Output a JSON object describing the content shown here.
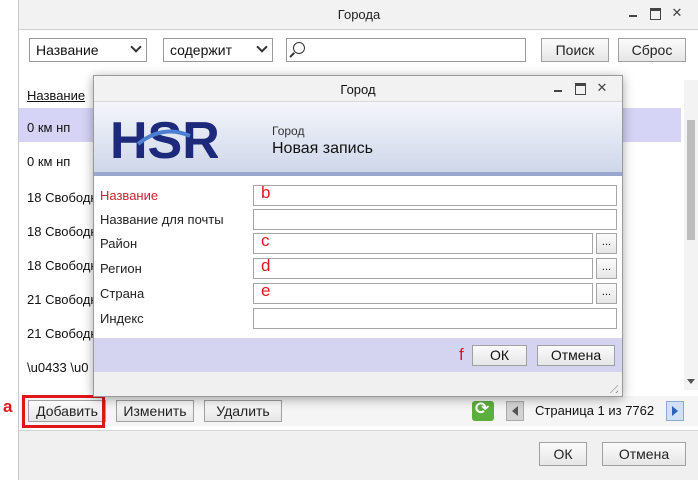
{
  "annotations": {
    "a": "a",
    "b": "b",
    "c": "c",
    "d": "d",
    "e": "e",
    "f": "f"
  },
  "outer": {
    "title": "Города",
    "field_select": "Название",
    "op_select": "содержит",
    "search_value": "",
    "search_btn": "Поиск",
    "reset_btn": "Сброс",
    "column_header": "Название",
    "rows": [
      "0 км нп",
      "0 км нп",
      "18 Свободн",
      "18 Свободн",
      "18 Свободн",
      "21 Свободн",
      "21 Свободн",
      "\\u0433 \\u0"
    ],
    "toolbar": {
      "add": "Добавить",
      "edit": "Изменить",
      "delete": "Удалить",
      "pager": "Страница 1 из 7762"
    },
    "ok": "ОК",
    "cancel": "Отмена"
  },
  "dialog": {
    "title": "Город",
    "logo": "HSR",
    "sub": "Город",
    "heading": "Новая запись",
    "fields": [
      {
        "label": "Название",
        "value": "",
        "required": true,
        "lookup": false
      },
      {
        "label": "Название для почты",
        "value": "",
        "required": false,
        "lookup": false
      },
      {
        "label": "Район",
        "value": "",
        "required": false,
        "lookup": true
      },
      {
        "label": "Регион",
        "value": "",
        "required": false,
        "lookup": true
      },
      {
        "label": "Страна",
        "value": "",
        "required": false,
        "lookup": true
      },
      {
        "label": "Индекс",
        "value": "",
        "required": false,
        "lookup": false
      }
    ],
    "lookup_btn": "...",
    "ok": "ОК",
    "cancel": "Отмена"
  },
  "colors": {
    "accent_red": "#e1161b",
    "selected_row": "#d6d4f6",
    "logo_blue": "#1d2a7c"
  }
}
